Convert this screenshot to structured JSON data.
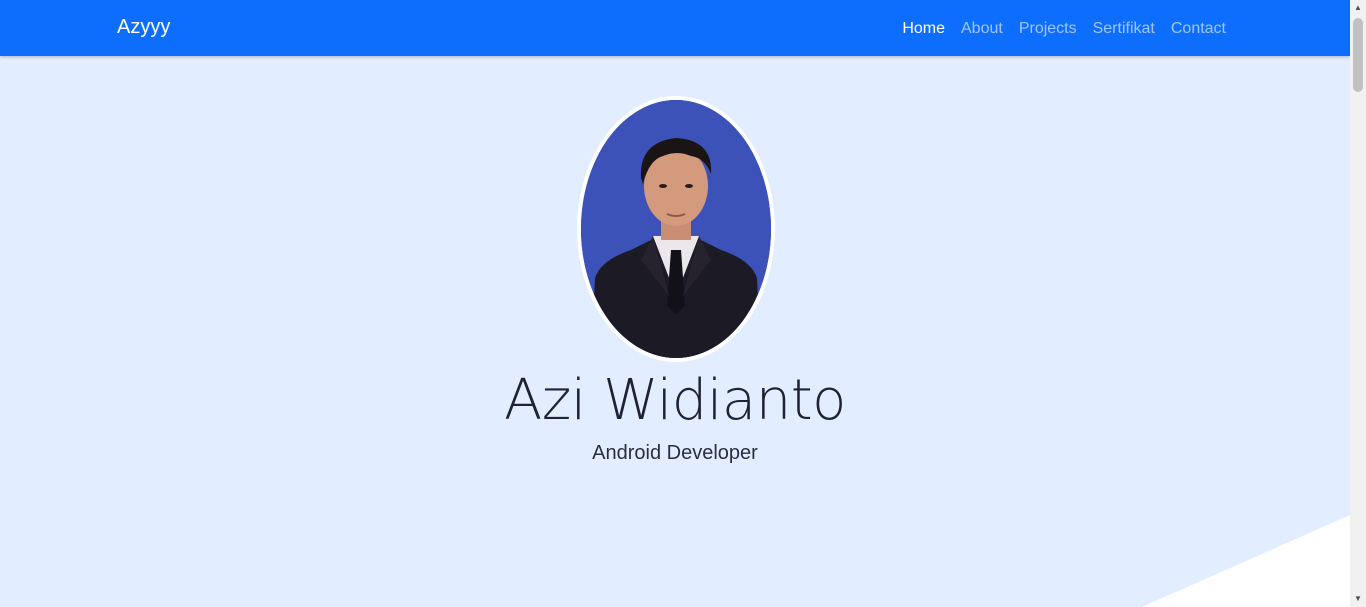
{
  "navbar": {
    "brand": "Azyyy",
    "links": [
      {
        "label": "Home",
        "active": true
      },
      {
        "label": "About",
        "active": false
      },
      {
        "label": "Projects",
        "active": false
      },
      {
        "label": "Sertifikat",
        "active": false
      },
      {
        "label": "Contact",
        "active": false
      }
    ]
  },
  "hero": {
    "name": "Azi Widianto",
    "role": "Android Developer",
    "photo_icon": "profile-photo"
  },
  "colors": {
    "navbar_bg": "#0d6efd",
    "hero_bg": "#e2edff",
    "photo_bg": "#3d52b8"
  },
  "scrollbar": {
    "up_icon": "▲",
    "down_icon": "▼"
  }
}
